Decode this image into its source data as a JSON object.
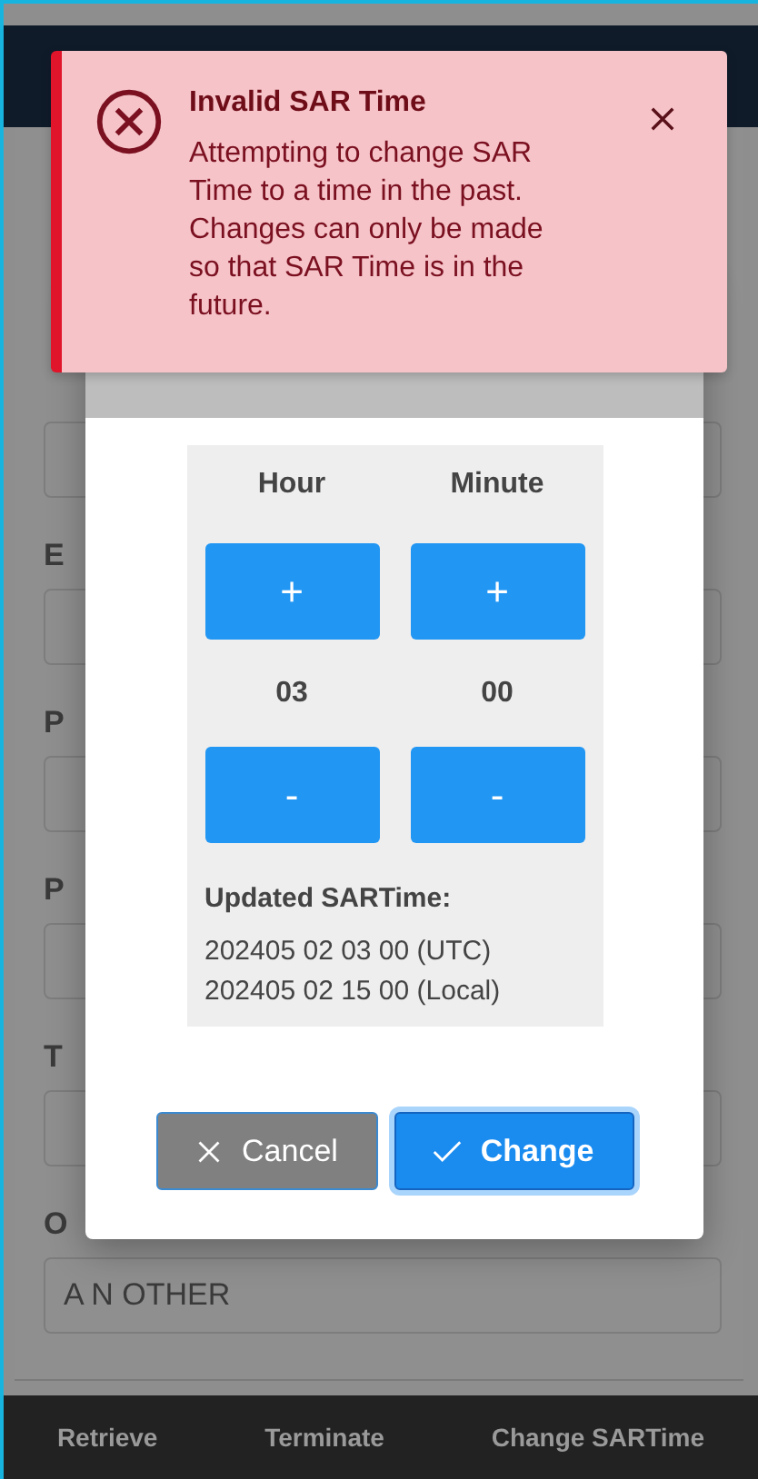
{
  "form": {
    "fields": [
      {
        "label": "E"
      },
      {
        "label": "P"
      },
      {
        "label": "P"
      },
      {
        "label": "T"
      },
      {
        "label": "O",
        "value": "A N OTHER"
      }
    ]
  },
  "dialog": {
    "columns": [
      {
        "label": "Hour",
        "increment": "+",
        "value": "03",
        "decrement": "-"
      },
      {
        "label": "Minute",
        "increment": "+",
        "value": "00",
        "decrement": "-"
      }
    ],
    "updated_label": "Updated SARTime:",
    "updated_lines": [
      "202405 02 03 00 (UTC)",
      "202405 02 15 00 (Local)"
    ],
    "buttons": [
      {
        "label": "Cancel",
        "kind": "cancel"
      },
      {
        "label": "Change",
        "kind": "confirm"
      }
    ]
  },
  "toast": {
    "title": "Invalid SAR Time",
    "message": "Attempting to change SAR Time to a time in the past. Changes can only be made so that SAR Time is in the future."
  },
  "bottom_bar": [
    "Retrieve",
    "Terminate",
    "Change SARTime"
  ]
}
